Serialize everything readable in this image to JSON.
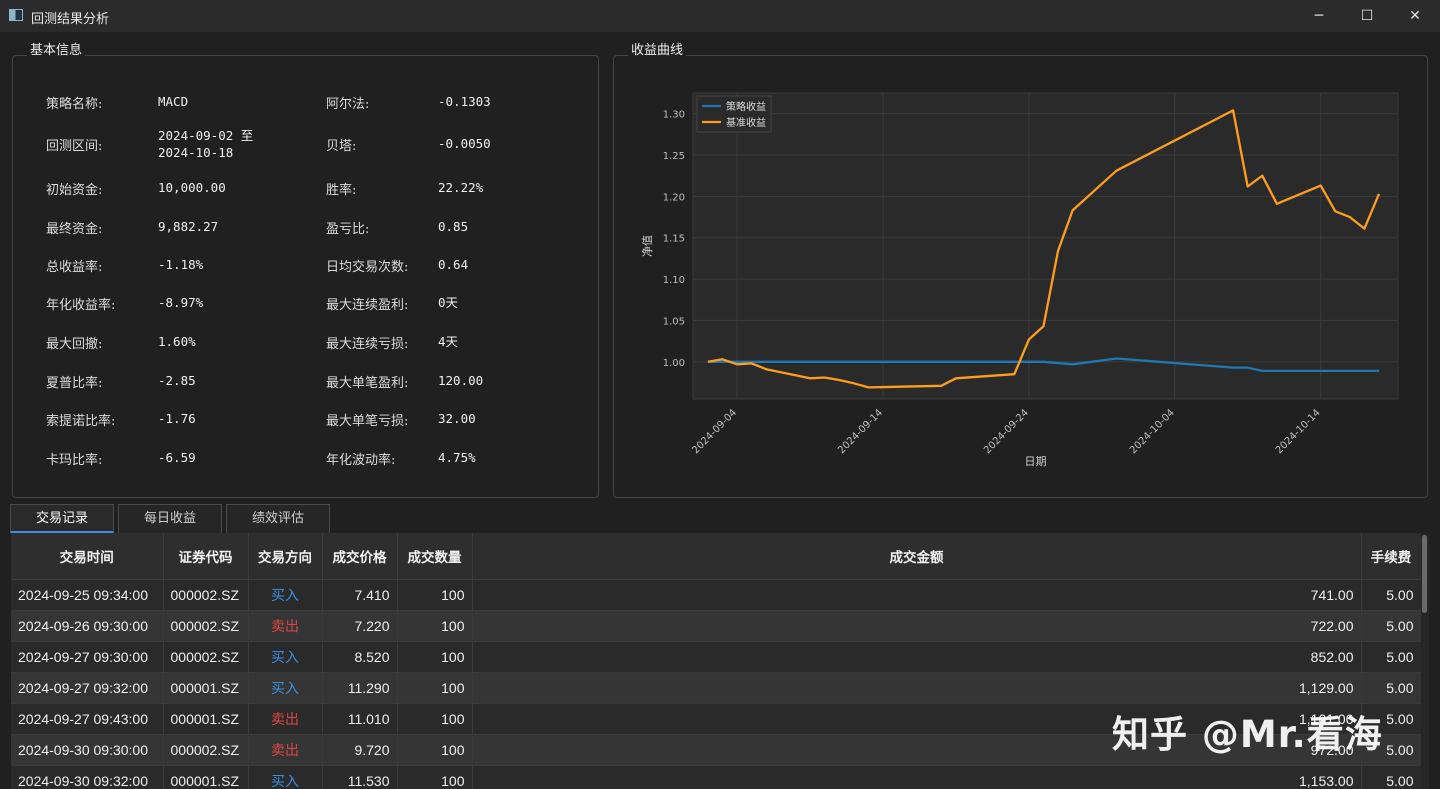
{
  "window": {
    "title": "回测结果分析",
    "minimize_glyph": "─",
    "maximize_glyph": "☐",
    "close_glyph": "✕"
  },
  "basic_info": {
    "title": "基本信息",
    "left": [
      {
        "label": "策略名称:",
        "value": "MACD"
      },
      {
        "label": "回测区间:",
        "value": "2024-09-02 至",
        "value2": "2024-10-18"
      },
      {
        "label": "初始资金:",
        "value": "10,000.00"
      },
      {
        "label": "最终资金:",
        "value": "9,882.27"
      },
      {
        "label": "总收益率:",
        "value": "-1.18%"
      },
      {
        "label": "年化收益率:",
        "value": "-8.97%"
      },
      {
        "label": "最大回撤:",
        "value": "1.60%"
      },
      {
        "label": "夏普比率:",
        "value": "-2.85"
      },
      {
        "label": "索提诺比率:",
        "value": "-1.76"
      },
      {
        "label": "卡玛比率:",
        "value": "-6.59"
      }
    ],
    "right": [
      {
        "label": "阿尔法:",
        "value": "-0.1303"
      },
      {
        "label": "贝塔:",
        "value": "-0.0050"
      },
      {
        "label": "胜率:",
        "value": "22.22%"
      },
      {
        "label": "盈亏比:",
        "value": "0.85"
      },
      {
        "label": "日均交易次数:",
        "value": "0.64"
      },
      {
        "label": "最大连续盈利:",
        "value": "0天"
      },
      {
        "label": "最大连续亏损:",
        "value": "4天"
      },
      {
        "label": "最大单笔盈利:",
        "value": "120.00"
      },
      {
        "label": "最大单笔亏损:",
        "value": "32.00"
      },
      {
        "label": "年化波动率:",
        "value": "4.75%"
      }
    ]
  },
  "chart_panel": {
    "title": "收益曲线"
  },
  "chart_data": {
    "type": "line",
    "xlabel": "日期",
    "ylabel": "净值",
    "ylim": [
      0.955,
      1.325
    ],
    "yticks": [
      1.0,
      1.05,
      1.1,
      1.15,
      1.2,
      1.25,
      1.3
    ],
    "xticks": [
      "2024-09-04",
      "2024-09-14",
      "2024-09-24",
      "2024-10-04",
      "2024-10-14"
    ],
    "grid": true,
    "legend": "top-left",
    "series": [
      {
        "name": "策略收益",
        "color": "#1f77b4",
        "points": [
          [
            "2024-09-02",
            1.0
          ],
          [
            "2024-09-05",
            1.0
          ],
          [
            "2024-09-10",
            1.0
          ],
          [
            "2024-09-15",
            1.0
          ],
          [
            "2024-09-20",
            1.0
          ],
          [
            "2024-09-25",
            1.0
          ],
          [
            "2024-09-27",
            0.997
          ],
          [
            "2024-09-30",
            1.004
          ],
          [
            "2024-10-08",
            0.993
          ],
          [
            "2024-10-09",
            0.993
          ],
          [
            "2024-10-10",
            0.989
          ],
          [
            "2024-10-14",
            0.989
          ],
          [
            "2024-10-18",
            0.989
          ]
        ]
      },
      {
        "name": "基准收益",
        "color": "#ff9e1b",
        "points": [
          [
            "2024-09-02",
            1.0
          ],
          [
            "2024-09-03",
            1.003
          ],
          [
            "2024-09-04",
            0.997
          ],
          [
            "2024-09-05",
            0.998
          ],
          [
            "2024-09-06",
            0.991
          ],
          [
            "2024-09-09",
            0.98
          ],
          [
            "2024-09-10",
            0.981
          ],
          [
            "2024-09-11",
            0.978
          ],
          [
            "2024-09-12",
            0.974
          ],
          [
            "2024-09-13",
            0.969
          ],
          [
            "2024-09-18",
            0.971
          ],
          [
            "2024-09-19",
            0.98
          ],
          [
            "2024-09-23",
            0.985
          ],
          [
            "2024-09-24",
            1.027
          ],
          [
            "2024-09-25",
            1.043
          ],
          [
            "2024-09-26",
            1.134
          ],
          [
            "2024-09-27",
            1.183
          ],
          [
            "2024-09-30",
            1.231
          ],
          [
            "2024-10-08",
            1.304
          ],
          [
            "2024-10-09",
            1.212
          ],
          [
            "2024-10-10",
            1.225
          ],
          [
            "2024-10-11",
            1.191
          ],
          [
            "2024-10-14",
            1.213
          ],
          [
            "2024-10-15",
            1.182
          ],
          [
            "2024-10-16",
            1.175
          ],
          [
            "2024-10-17",
            1.161
          ],
          [
            "2024-10-18",
            1.203
          ]
        ]
      }
    ]
  },
  "tabs": [
    "交易记录",
    "每日收益",
    "绩效评估"
  ],
  "trades": {
    "headers": [
      "交易时间",
      "证券代码",
      "交易方向",
      "成交价格",
      "成交数量",
      "成交金额",
      "手续费"
    ],
    "rows": [
      {
        "time": "2024-09-25 09:34:00",
        "code": "000002.SZ",
        "dir": "买入",
        "price": "7.410",
        "qty": "100",
        "amount": "741.00",
        "fee": "5.00"
      },
      {
        "time": "2024-09-26 09:30:00",
        "code": "000002.SZ",
        "dir": "卖出",
        "price": "7.220",
        "qty": "100",
        "amount": "722.00",
        "fee": "5.00"
      },
      {
        "time": "2024-09-27 09:30:00",
        "code": "000002.SZ",
        "dir": "买入",
        "price": "8.520",
        "qty": "100",
        "amount": "852.00",
        "fee": "5.00"
      },
      {
        "time": "2024-09-27 09:32:00",
        "code": "000001.SZ",
        "dir": "买入",
        "price": "11.290",
        "qty": "100",
        "amount": "1,129.00",
        "fee": "5.00"
      },
      {
        "time": "2024-09-27 09:43:00",
        "code": "000001.SZ",
        "dir": "卖出",
        "price": "11.010",
        "qty": "100",
        "amount": "1,101.00",
        "fee": "5.00"
      },
      {
        "time": "2024-09-30 09:30:00",
        "code": "000002.SZ",
        "dir": "卖出",
        "price": "9.720",
        "qty": "100",
        "amount": "972.00",
        "fee": "5.00"
      },
      {
        "time": "2024-09-30 09:32:00",
        "code": "000001.SZ",
        "dir": "买入",
        "price": "11.530",
        "qty": "100",
        "amount": "1,153.00",
        "fee": "5.00"
      }
    ]
  },
  "watermark": "知乎 @Mr.看海",
  "colors": {
    "buy": "#3b8fe0",
    "sell": "#e04545",
    "accent": "#3a8fd8"
  }
}
